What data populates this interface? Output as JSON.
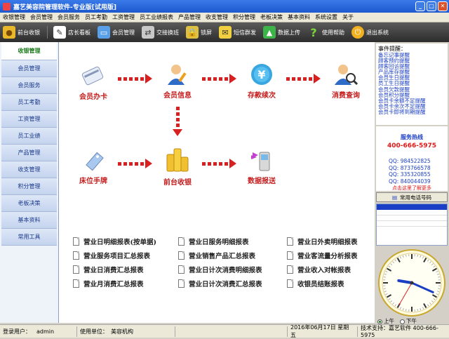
{
  "window": {
    "title": "嘉艺美容院管理软件-专业版[试用版]"
  },
  "menu": [
    "收银管理",
    "会员管理",
    "会员服务",
    "员工考勤",
    "工资管理",
    "员工业绩报表",
    "产品管理",
    "收支管理",
    "积分管理",
    "老板决策",
    "基本资料",
    "系统设置",
    "关于"
  ],
  "toolbar": {
    "items": [
      {
        "label": "前台收银",
        "icon": "coins-icon"
      },
      {
        "label": "店长看板",
        "icon": "pencil-icon"
      },
      {
        "label": "会员管理",
        "icon": "card-icon"
      },
      {
        "label": "交接换班",
        "icon": "handover-icon"
      },
      {
        "label": "锁屏",
        "icon": "lock-icon"
      },
      {
        "label": "短信群发",
        "icon": "sms-icon"
      },
      {
        "label": "数据上传",
        "icon": "upload-icon"
      },
      {
        "label": "使用帮助",
        "icon": "help-icon"
      },
      {
        "label": "退出系统",
        "icon": "exit-icon"
      }
    ]
  },
  "sidebar": {
    "items": [
      "收银管理",
      "会员管理",
      "会员服务",
      "员工考勤",
      "工资管理",
      "员工业绩",
      "产品管理",
      "收支管理",
      "积分管理",
      "老板决策",
      "基本资料",
      "常用工具"
    ]
  },
  "flow": {
    "card": "会员办卡",
    "info": "会员信息",
    "deposit": "存款续次",
    "query": "消费查询",
    "bed": "床位手牌",
    "cashier": "前台收银",
    "report": "数据报送"
  },
  "reports": [
    "营业日明细报表(按单据)",
    "营业日服务明细报表",
    "营业日外卖明细报表",
    "营业服务项目汇总报表",
    "营业销售产品汇总报表",
    "营业客流量分析报表",
    "营业日消费汇总报表",
    "营业日计次消费明细报表",
    "营业收入对帐报表",
    "营业月消费汇总报表",
    "营业日计次消费汇总报表",
    "收银员结账报表"
  ],
  "reminders": {
    "title": "事件提醒：",
    "items": [
      "备忘记事提醒",
      "顾客预约提醒",
      "顾客回访提醒",
      "产品库存提醒",
      "会员生日提醒",
      "员工生日提醒",
      "会员欠款提醒",
      "会员积分提醒",
      "会员卡余额不足提醒",
      "会员卡余次不足提醒",
      "会员卡即将到期提醒"
    ]
  },
  "hotline": {
    "title": "服务热线",
    "phone": "400-666-5975",
    "qq": [
      "QQ: 984522825",
      "QQ: 873766578",
      "QQ: 335320855",
      "QQ: 840044039"
    ],
    "promo": "点击这里了解更多"
  },
  "phone_button": "常用电话号码",
  "clock": {
    "hour": 9,
    "minute": 19,
    "second": 35
  },
  "ampm": {
    "am": "上午",
    "pm": "下午",
    "selected": "am"
  },
  "status": {
    "user_label": "登录用户：",
    "user": "admin",
    "unit_label": "使用单位：",
    "unit": "美容机构",
    "date": "2016年06月17日 星期五",
    "support": "技术支持：嘉艺软件 400-666-5975"
  }
}
